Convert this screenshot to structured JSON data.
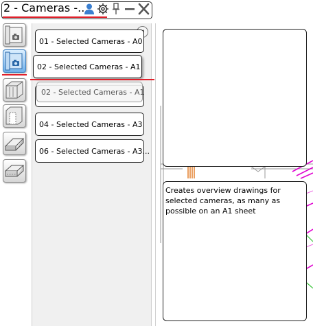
{
  "window": {
    "title": "2 - Cameras -..."
  },
  "titlebar_icons": [
    "user-icon",
    "gear-icon",
    "pin-icon",
    "minimize-icon",
    "close-icon"
  ],
  "tools": [
    {
      "icon": "camera-view-tool-icon",
      "active": false
    },
    {
      "icon": "camera-selected-tool-icon",
      "active": true
    },
    {
      "icon": "wall-section-tool-icon",
      "active": false
    },
    {
      "icon": "door-frame-tool-icon",
      "active": false
    },
    {
      "icon": "beam-tool-icon",
      "active": false
    },
    {
      "icon": "slab-tool-icon",
      "active": false
    }
  ],
  "camera_list": {
    "items": [
      {
        "label": "01 - Selected Cameras - A0",
        "selected": false
      },
      {
        "label": "02 - Selected Cameras - A1",
        "selected": true
      },
      {
        "label": "04 - Selected Cameras - A3",
        "selected": false
      },
      {
        "label": "06 - Selected Cameras - A3...",
        "selected": false
      }
    ],
    "drag_ghost_label": "02 - Selected Cameras - A1"
  },
  "description": "Creates overview drawings for selected cameras, as many as possible on an A1 sheet",
  "colors": {
    "accent_underline": "#e0202a",
    "active_tool": "#6fb0ea",
    "drawing_magenta": "#e000d0",
    "drawing_orange": "#e07820",
    "drawing_green": "#3cc43c"
  }
}
